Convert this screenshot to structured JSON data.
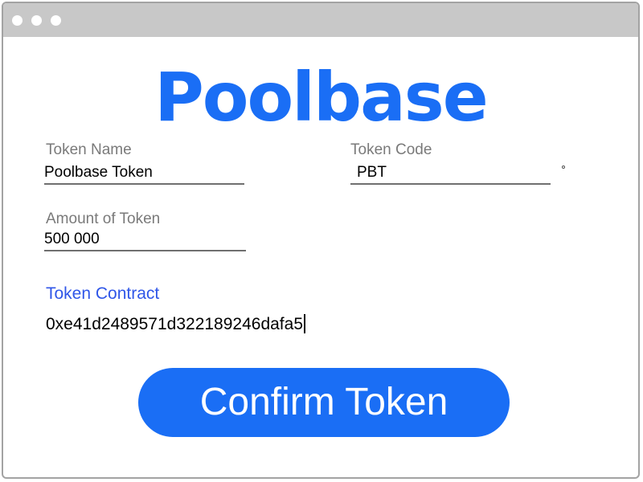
{
  "colors": {
    "brand": "#1a6ef5",
    "accent": "#2f56e8",
    "titlebar": "#c8c8c8",
    "label_text": "#7a7a7a"
  },
  "window": {
    "controls": [
      "window-dot",
      "window-dot",
      "window-dot"
    ]
  },
  "logo": {
    "text": "Poolbase"
  },
  "form": {
    "token_name": {
      "label": "Token Name",
      "value": "Poolbase Token"
    },
    "token_code": {
      "label": "Token Code",
      "value": "PBT"
    },
    "amount": {
      "label": "Amount of Token",
      "value": "500 000"
    },
    "contract": {
      "label": "Token Contract",
      "value": "0xe41d2489571d322189246dafa5"
    }
  },
  "confirm_button": {
    "label": "Confirm Token"
  }
}
